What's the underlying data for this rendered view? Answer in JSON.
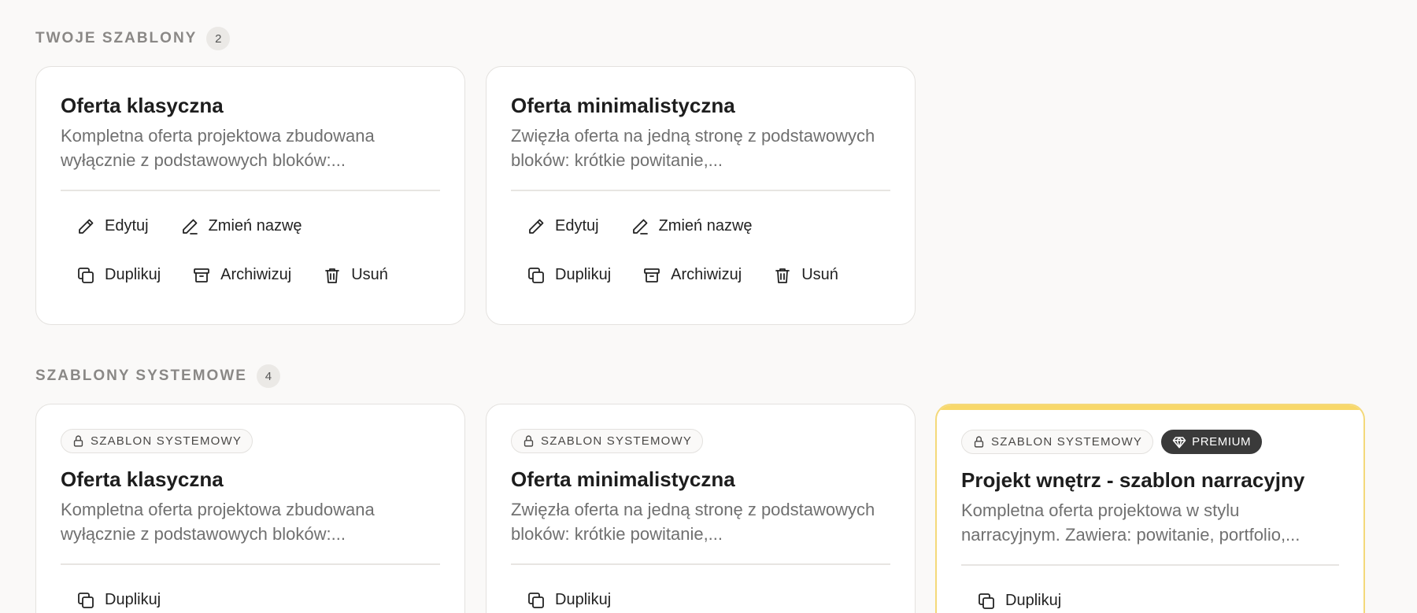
{
  "user_section": {
    "title": "TWOJE SZABLONY",
    "count": "2",
    "cards": [
      {
        "title": "Oferta klasyczna",
        "description": "Kompletna oferta projektowa zbudowana wyłącznie z podstawowych bloków:...",
        "actions": [
          "Edytuj",
          "Zmień nazwę",
          "Duplikuj",
          "Archiwizuj",
          "Usuń"
        ]
      },
      {
        "title": "Oferta minimalistyczna",
        "description": "Zwięzła oferta na jedną stronę z podstawowych bloków: krótkie powitanie,...",
        "actions": [
          "Edytuj",
          "Zmień nazwę",
          "Duplikuj",
          "Archiwizuj",
          "Usuń"
        ]
      }
    ]
  },
  "system_section": {
    "title": "SZABLONY SYSTEMOWE",
    "count": "4",
    "cards": [
      {
        "chip": "SZABLON SYSTEMOWY",
        "title": "Oferta klasyczna",
        "description": "Kompletna oferta projektowa zbudowana wyłącznie z podstawowych bloków:...",
        "action": "Duplikuj"
      },
      {
        "chip": "SZABLON SYSTEMOWY",
        "title": "Oferta minimalistyczna",
        "description": "Zwięzła oferta na jedną stronę z podstawowych bloków: krótkie powitanie,...",
        "action": "Duplikuj"
      },
      {
        "chip": "SZABLON SYSTEMOWY",
        "premium_chip": "PREMIUM",
        "title": "Projekt wnętrz - szablon narracyjny",
        "description": "Kompletna oferta projektowa w stylu narracyjnym. Zawiera: powitanie, portfolio,...",
        "action": "Duplikuj"
      }
    ]
  },
  "icons": {
    "edit": "pencil-icon",
    "rename": "pencil-line-icon",
    "duplicate": "copy-icon",
    "archive": "archive-box-icon",
    "delete": "trash-icon",
    "system": "lock-icon",
    "premium": "diamond-icon"
  },
  "colors": {
    "background": "#faf9f8",
    "card": "#ffffff",
    "premium_accent": "#f8d86a",
    "premium_chip": "#3a3a3a"
  }
}
